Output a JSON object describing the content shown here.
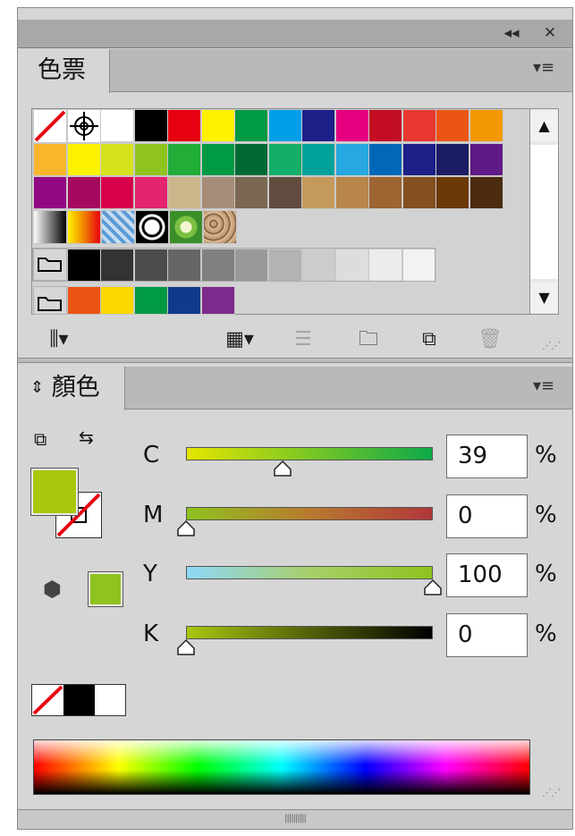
{
  "window": {
    "collapse_icon": "double-left-arrow-icon",
    "collapse_glyph": "◂◂",
    "close_icon": "close-icon",
    "close_glyph": "✕"
  },
  "swatches_panel": {
    "tab_label": "色票",
    "menu_glyph": "▾≡",
    "rows": [
      [
        "#ffffff",
        "#ffffff",
        "#ffffff",
        "#000000",
        "#e60012",
        "#fff100",
        "#009944",
        "#00a0e9",
        "#1d2088",
        "#e4007f",
        "#c30d23",
        "#e8382f",
        "#ea5514",
        "#f39800"
      ],
      [
        "#f8b62d",
        "#fcf200",
        "#d7e21f",
        "#8fc31f",
        "#22ac38",
        "#009944",
        "#006934",
        "#13ae67",
        "#00a29a",
        "#27a8e0",
        "#0068b7",
        "#1d2088",
        "#1b1c63",
        "#601986"
      ],
      [
        "#920783",
        "#a40b5e",
        "#d7004b",
        "#e4246f",
        "#cbb78b",
        "#a68d77",
        "#7a6751",
        "#604c3f",
        "#c49a5c",
        "#b8864b",
        "#9e6432",
        "#85501f",
        "#6a3906",
        "#4c2c10"
      ],
      [
        "#000000",
        "#000000",
        "#333333",
        "#4c4c4c",
        "#666666",
        "#808080",
        "#999999",
        "#b3b3b3",
        "#cccccc",
        "#dddddd",
        "#ececec",
        "#f2f2f2"
      ],
      [
        "#e60012",
        "#ea5514",
        "#fcd800",
        "#009944",
        "#0f3b8c",
        "#7c2b8c"
      ]
    ],
    "scroll_up_glyph": "▲",
    "scroll_down_glyph": "▼",
    "toolbar": {
      "library_glyph": "⫼▾",
      "show_kinds_glyph": "▦▾",
      "options_glyph": "☰",
      "new_group_glyph": "🗀",
      "new_swatch_glyph": "⧉",
      "delete_glyph": "🗑"
    }
  },
  "color_panel": {
    "tab_label": "顏色",
    "tab_arrow_glyph": "⇕",
    "menu_glyph": "▾≡",
    "default_icon_glyph": "⧉",
    "swap_icon_glyph": "⇆",
    "fill_color": "#a8c80e",
    "gamut_icon_glyph": "⬢",
    "gamut_color": "#8fc31f",
    "channels": [
      {
        "label": "C",
        "value": "39",
        "percent": "%",
        "level": 0.39,
        "gradient": "linear-gradient(to right,#e5e500,#0fa94a)"
      },
      {
        "label": "M",
        "value": "0",
        "percent": "%",
        "level": 0.0,
        "gradient": "linear-gradient(to right,#8fc31f,#b87a2f,#b0373b)"
      },
      {
        "label": "Y",
        "value": "100",
        "percent": "%",
        "level": 1.0,
        "gradient": "linear-gradient(to right,#8ed8f8,#a8cf6a,#8fc31f)"
      },
      {
        "label": "K",
        "value": "0",
        "percent": "%",
        "level": 0.0,
        "gradient": "linear-gradient(to right,#a8c80e,#52620a,#000000)"
      }
    ]
  }
}
